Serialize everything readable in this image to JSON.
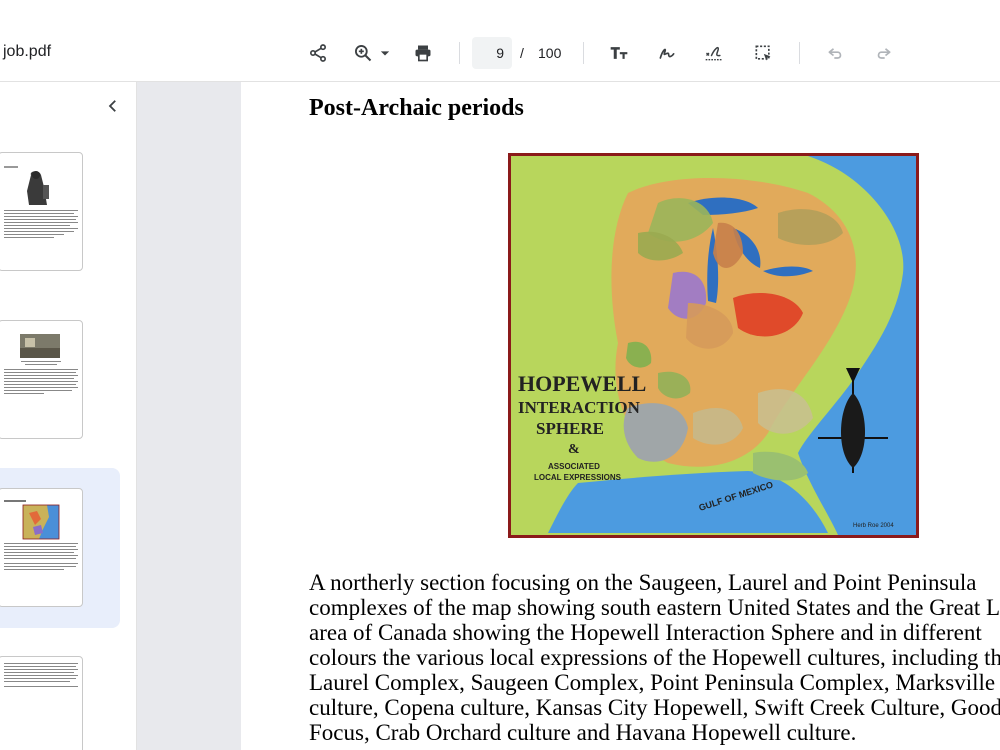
{
  "file": {
    "title": "job.pdf"
  },
  "toolbar": {
    "icons": [
      "share-icon",
      "zoom-in-icon",
      "chevron-down-icon",
      "print-icon",
      "text-size-icon",
      "draw-icon",
      "signature-icon",
      "select-area-icon",
      "undo-icon",
      "redo-icon"
    ],
    "current_page": "9",
    "page_separator": "/",
    "total_pages": "100"
  },
  "sidebar": {
    "collapse_icon": "chevron-left-icon",
    "selected_index": 2
  },
  "document": {
    "heading": "Post-Archaic periods",
    "map": {
      "title_line1": "HOPEWELL",
      "title_line2": "INTERACTION",
      "title_line3": "SPHERE",
      "ampersand": "&",
      "subtitle_line1": "ASSOCIATED",
      "subtitle_line2": "LOCAL EXPRESSIONS",
      "gulf_label": "GULF OF MEXICO",
      "signature": "Herb Roe 2004"
    },
    "body_lines": [
      "A northerly section focusing on the Saugeen, Laurel and Point Peninsula",
      "complexes of the map showing south eastern United States and the Great Lakes",
      "area of Canada showing the Hopewell Interaction Sphere and in different",
      "colours the various local expressions of the Hopewell cultures, including the",
      "Laurel Complex, Saugeen Complex, Point Peninsula Complex, Marksville",
      "culture, Copena culture, Kansas City Hopewell, Swift Creek Culture, Goodall",
      "Focus, Crab Orchard culture and Havana Hopewell culture."
    ]
  },
  "colors": {
    "accent_selected": "#e8eefb",
    "gutter": "#e8e9ed",
    "map_border": "#8b1a1a"
  }
}
